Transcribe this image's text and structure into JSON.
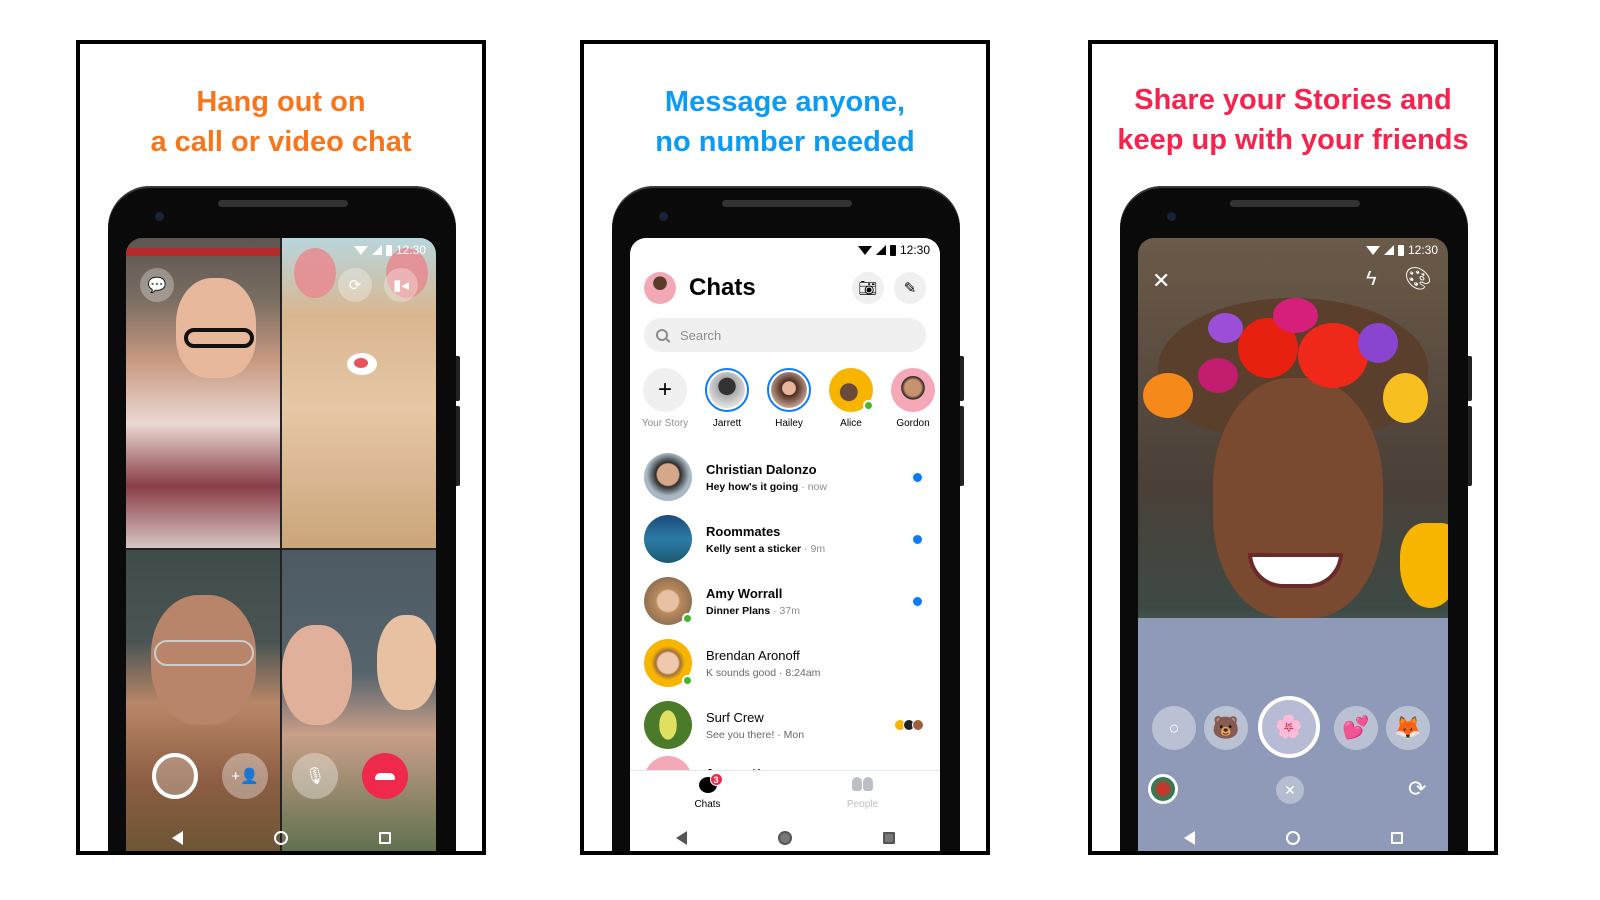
{
  "panels": [
    {
      "headline_line1": "Hang out on",
      "headline_line2": "a call or video chat",
      "headline_color": "#f7761c",
      "status_time": "12:30",
      "video_participants": [
        {
          "label": "Participant waving, glasses, patterned shirt"
        },
        {
          "label": "Participant with bunny ears filter"
        },
        {
          "label": "Participant with glasses, brown jacket"
        },
        {
          "label": "Two participants, glasses"
        }
      ],
      "top_icons": [
        "chat-bubble-icon",
        "flip-camera-icon",
        "video-camera-icon"
      ],
      "call_controls": [
        {
          "name": "capture-button",
          "icon": "circle-capture-icon"
        },
        {
          "name": "add-person-button",
          "icon": "add-person-icon",
          "glyph": "+👤"
        },
        {
          "name": "mute-button",
          "icon": "microphone-icon",
          "glyph": "🎙"
        },
        {
          "name": "end-call-button",
          "icon": "hang-up-icon",
          "glyph": "☎",
          "color": "#f02849"
        }
      ]
    },
    {
      "headline_line1": "Message anyone,",
      "headline_line2": "no number needed",
      "headline_color": "#0a9cf5",
      "status_time": "12:30",
      "title": "Chats",
      "search_placeholder": "Search",
      "stories": [
        {
          "name": "Your Story",
          "type": "add"
        },
        {
          "name": "Jarrett",
          "active": true
        },
        {
          "name": "Hailey",
          "active": true
        },
        {
          "name": "Alice",
          "online": true
        },
        {
          "name": "Gordon"
        }
      ],
      "chats": [
        {
          "name": "Christian Dalonzo",
          "snippet": "Hey how's it going",
          "time": "now",
          "unread": true,
          "online": false
        },
        {
          "name": "Roommates",
          "snippet": "Kelly sent a sticker",
          "time": "9m",
          "unread": true,
          "online": false
        },
        {
          "name": "Amy Worrall",
          "snippet": "Dinner Plans",
          "time": "37m",
          "unread": true,
          "online": true
        },
        {
          "name": "Brendan Aronoff",
          "snippet": "K sounds good",
          "time": "8:24am",
          "unread": false,
          "online": true
        },
        {
          "name": "Surf Crew",
          "snippet": "See you there!",
          "time": "Mon",
          "unread": false,
          "online": false,
          "seen_by": 3
        },
        {
          "name": "Jeremy Karm...",
          "snippet": "",
          "time": "",
          "unread": false,
          "partial": true
        }
      ],
      "tabs": [
        {
          "label": "Chats",
          "badge": "3",
          "active": true
        },
        {
          "label": "People",
          "active": false
        }
      ],
      "accent_color": "#0a7cff"
    },
    {
      "headline_line1": "Share your Stories and",
      "headline_line2": "keep up with your friends",
      "headline_color": "#f5234d",
      "status_time": "12:30",
      "top_icons": [
        "close-icon",
        "flash-off-icon",
        "palette-icon"
      ],
      "filters": [
        "none",
        "bear",
        "flower-crown",
        "heart-glasses",
        "fox"
      ],
      "selected_filter": "flower-crown"
    }
  ]
}
